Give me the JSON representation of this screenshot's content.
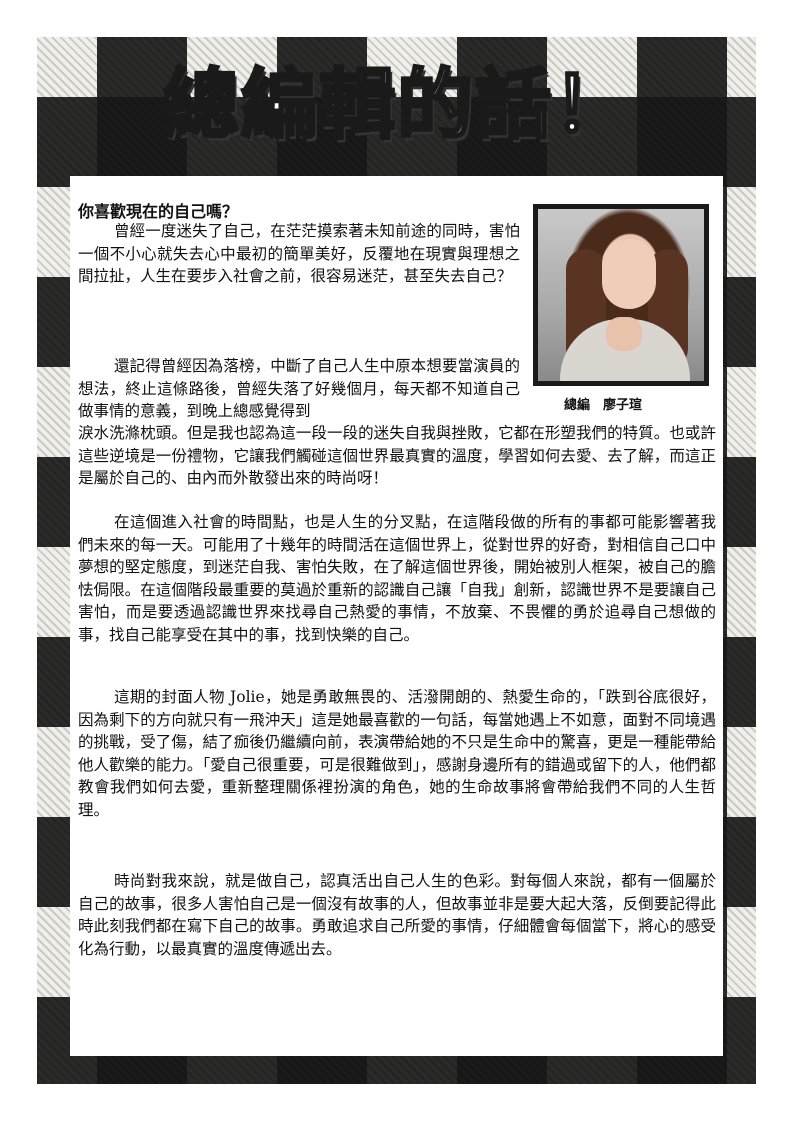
{
  "title": "總編輯的話！",
  "heading": "你喜歡現在的自己嗎？",
  "caption": "總編　廖子瑄",
  "paragraphs": {
    "p1": "曾經一度迷失了自己，在茫茫摸索著未知前途的同時，害怕一個不小心就失去心中最初的簡單美好，反覆地在現實與理想之間拉扯，人生在要步入社會之前，很容易迷茫，甚至失去自己？",
    "p2": "還記得曾經因為落榜，中斷了自己人生中原本想要當演員的想法，終止這條路後，曾經失落了好幾個月，每天都不知道自己做事情的意義，到晚上總感覺得到",
    "p2b": "淚水洗滌枕頭。但是我也認為這一段一段的迷失自我與挫敗，它都在形塑我們的特質。也或許這些逆境是一份禮物，它讓我們觸碰這個世界最真實的溫度，學習如何去愛、去了解，而這正是屬於自己的、由內而外散發出來的時尚呀！",
    "p3": "在這個進入社會的時間點，也是人生的分叉點，在這階段做的所有的事都可能影響著我們未來的每一天。可能用了十幾年的時間活在這個世界上，從對世界的好奇，對相信自己口中夢想的堅定態度，到迷茫自我、害怕失敗，在了解這個世界後，開始被別人框架，被自己的膽怯侷限。在這個階段最重要的莫過於重新的認識自己讓「自我」創新，認識世界不是要讓自己害怕，而是要透過認識世界來找尋自己熱愛的事情，不放棄、不畏懼的勇於追尋自己想做的事，找自己能享受在其中的事，找到快樂的自己。",
    "p4": "這期的封面人物 Jolie，她是勇敢無畏的、活潑開朗的、熱愛生命的，「跌到谷底很好，因為剩下的方向就只有一飛沖天」這是她最喜歡的一句話，每當她遇上不如意，面對不同境遇的挑戰，受了傷，結了痂後仍繼續向前，表演帶給她的不只是生命中的驚喜，更是一種能帶給他人歡樂的能力。「愛自己很重要，可是很難做到」，感謝身邊所有的錯過或留下的人，他們都教會我們如何去愛，重新整理關係裡扮演的角色，她的生命故事將會帶給我們不同的人生哲理。",
    "p5": "時尚對我來說，就是做自己，認真活出自己人生的色彩。對每個人來說，都有一個屬於自己的故事，很多人害怕自己是一個沒有故事的人，但故事並非是要大起大落，反倒要記得此時此刻我們都在寫下自己的故事。勇敢追求自己所愛的事情，仔細體會每個當下，將心的感受化為行動，以最真實的溫度傳遞出去。"
  }
}
